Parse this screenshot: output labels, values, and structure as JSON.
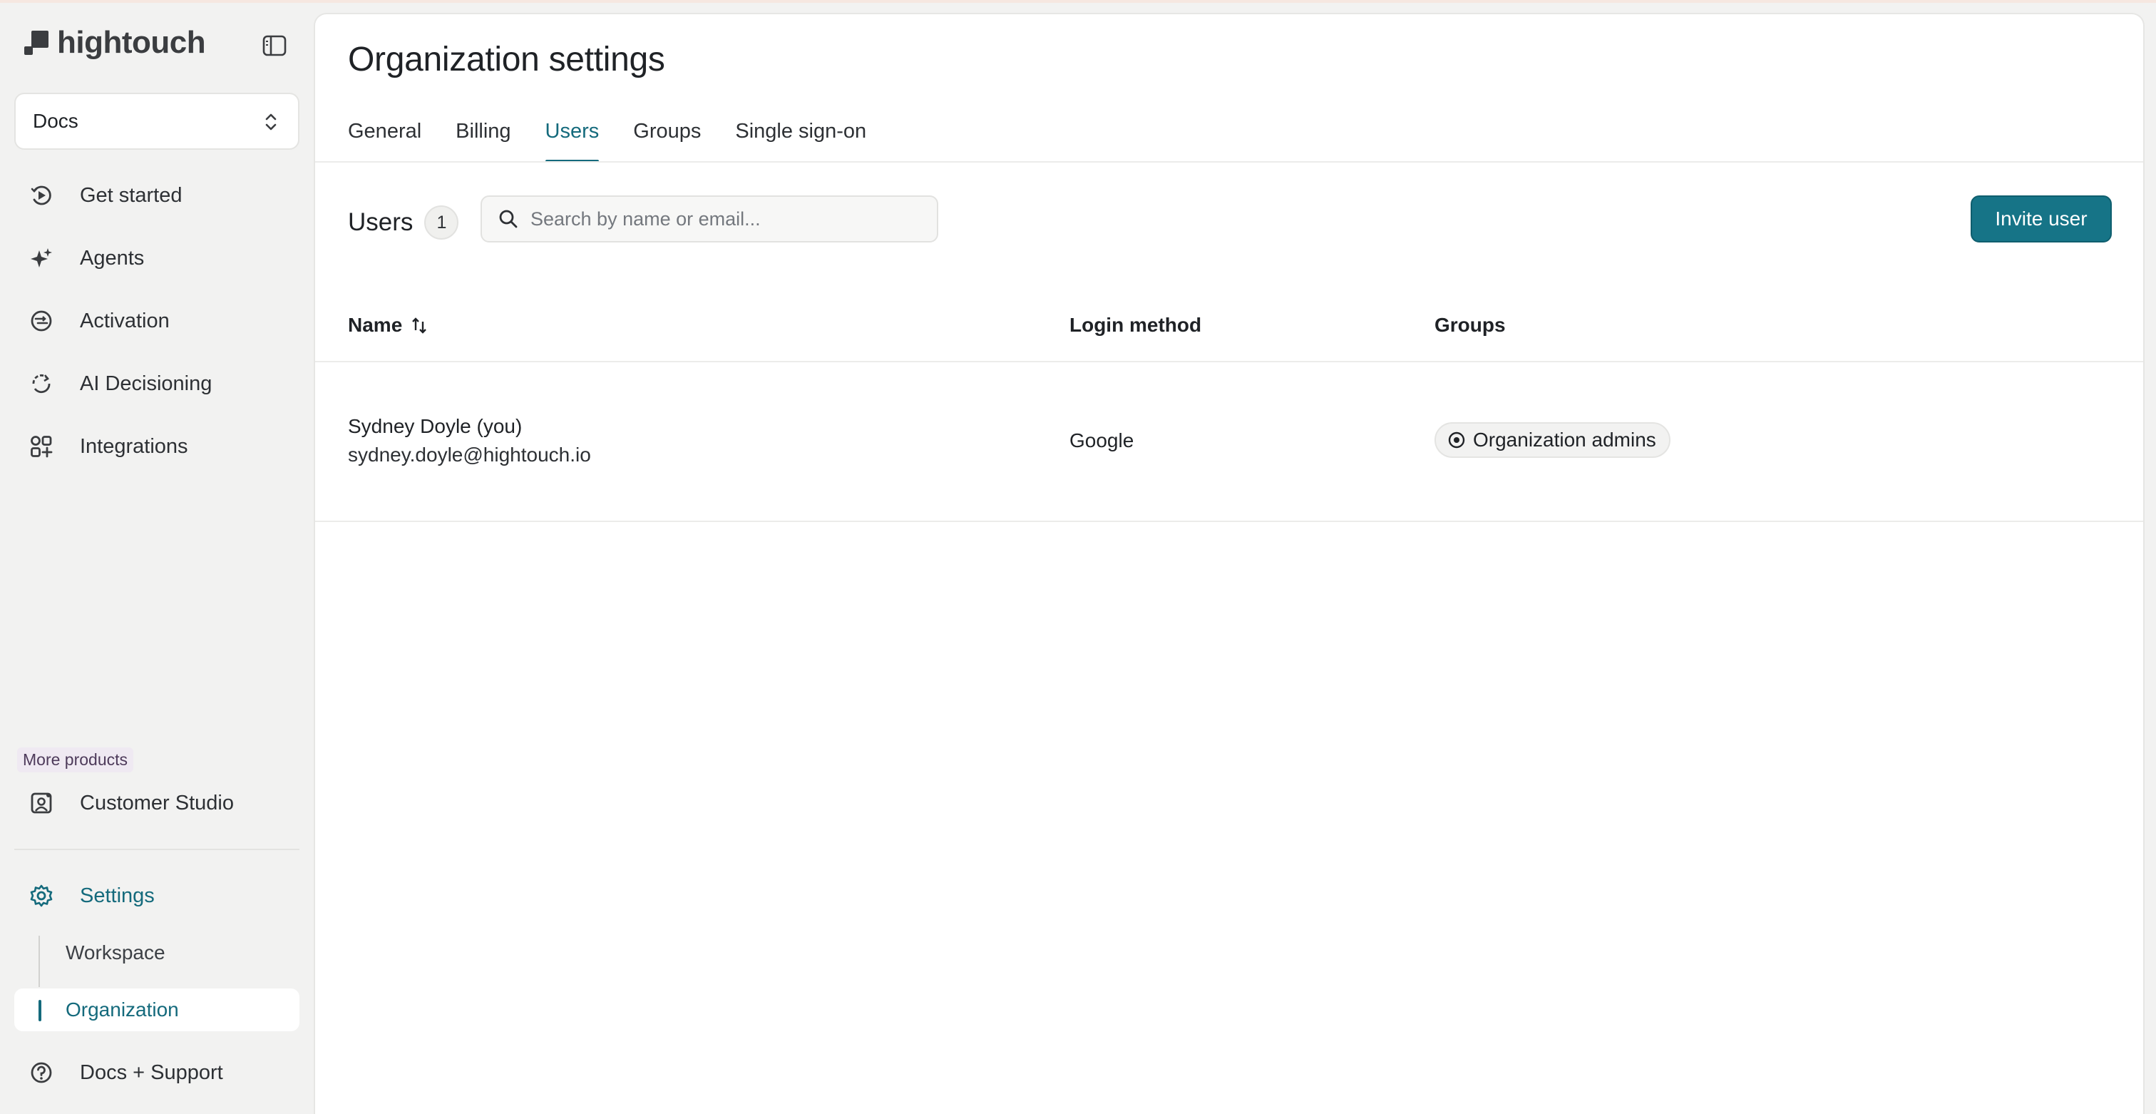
{
  "app": {
    "brand": "hightouch"
  },
  "sidebar": {
    "workspace": "Docs",
    "items": [
      {
        "label": "Get started",
        "icon": "get-started-icon"
      },
      {
        "label": "Agents",
        "icon": "sparkle-icon"
      },
      {
        "label": "Activation",
        "icon": "activation-icon"
      },
      {
        "label": "AI Decisioning",
        "icon": "refresh-icon"
      },
      {
        "label": "Integrations",
        "icon": "grid-plus-icon"
      }
    ],
    "more_products_label": "More products",
    "customer_studio": "Customer Studio",
    "settings": "Settings",
    "settings_sub": {
      "workspace": "Workspace",
      "organization": "Organization"
    },
    "support": "Docs + Support"
  },
  "main": {
    "title": "Organization settings",
    "tabs": [
      {
        "label": "General",
        "active": false
      },
      {
        "label": "Billing",
        "active": false
      },
      {
        "label": "Users",
        "active": true
      },
      {
        "label": "Groups",
        "active": false
      },
      {
        "label": "Single sign-on",
        "active": false
      }
    ],
    "users_title": "Users",
    "users_count": "1",
    "search_placeholder": "Search by name or email...",
    "invite_button": "Invite user",
    "columns": {
      "name": "Name",
      "login": "Login method",
      "groups": "Groups"
    },
    "rows": [
      {
        "name": "Sydney Doyle (you)",
        "email": "sydney.doyle@hightouch.io",
        "login": "Google",
        "group": "Organization admins"
      }
    ]
  },
  "colors": {
    "accent": "#167487",
    "active_text": "#146a7c",
    "background": "#f2f2f1"
  }
}
